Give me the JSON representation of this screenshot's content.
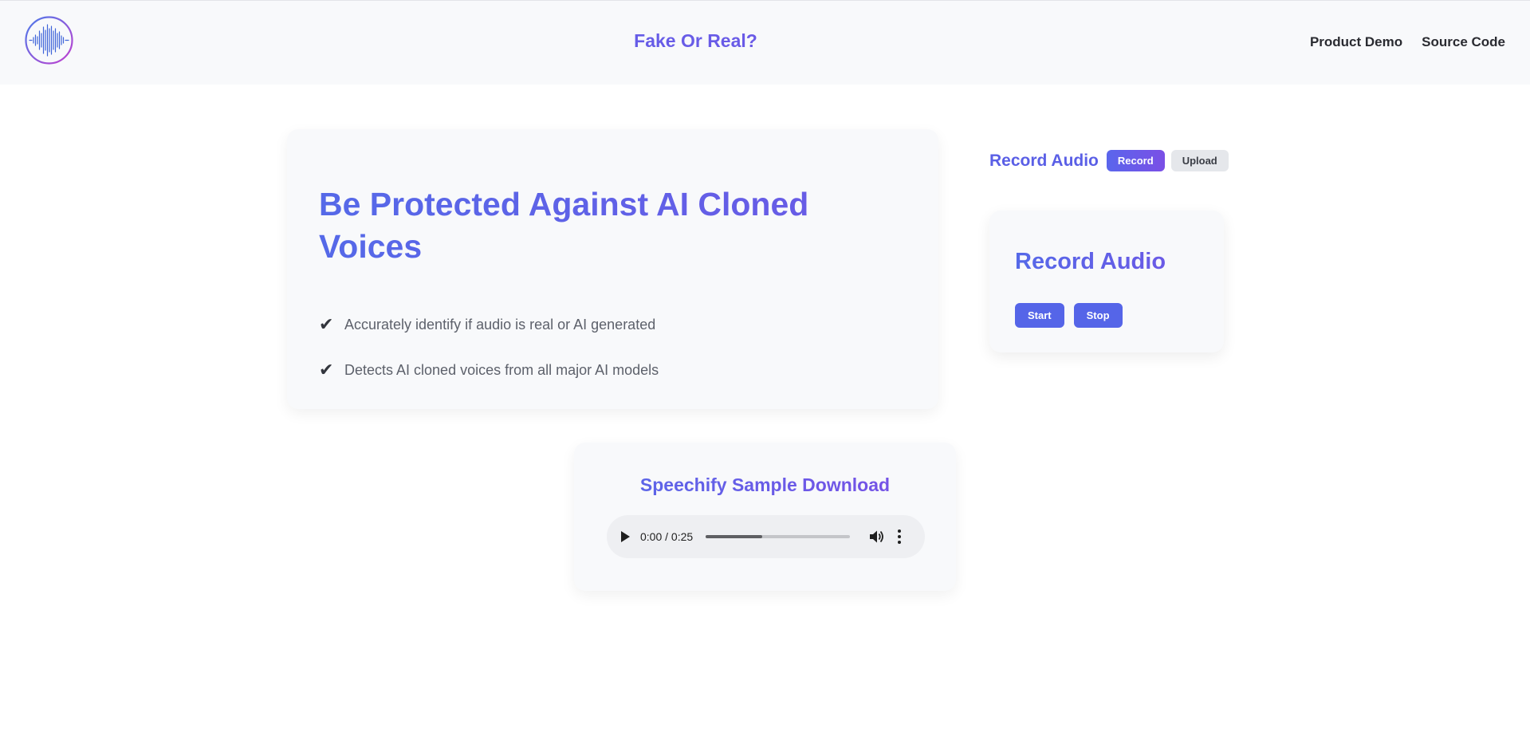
{
  "header": {
    "title": "Fake Or Real?",
    "nav": [
      "Product Demo",
      "Source Code"
    ],
    "logo_icon": "waveform-circle-icon",
    "brand_gradient": [
      "#5569e8",
      "#7b4ee6"
    ]
  },
  "hero": {
    "title": "Be Protected Against AI Cloned Voices",
    "features": [
      "Accurately identify if audio is real or AI generated",
      "Detects AI cloned voices from all major AI models"
    ],
    "check_icon": "checkmark-icon"
  },
  "record_section": {
    "label": "Record Audio",
    "mode_record": "Record",
    "mode_upload": "Upload",
    "active_mode": "Record"
  },
  "record_card": {
    "title": "Record Audio",
    "start": "Start",
    "stop": "Stop"
  },
  "sample": {
    "title": "Speechify Sample Download",
    "player": {
      "time": "0:00 / 0:25",
      "buffered_fraction": 0.39
    }
  },
  "colors": {
    "accent": "#5565e8",
    "accent_purple": "#7a4fe6",
    "card_bg": "#f8f9fb",
    "text_muted": "#5d616b"
  }
}
